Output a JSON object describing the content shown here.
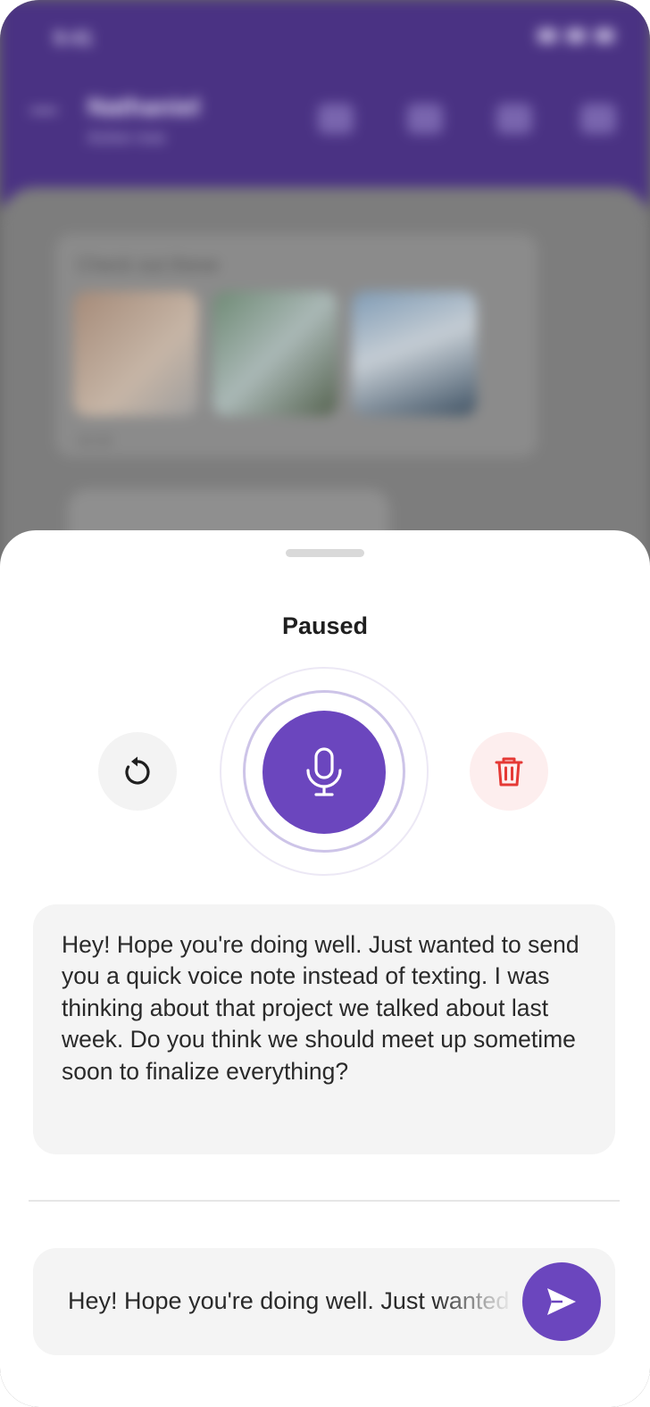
{
  "background_app": {
    "status_time": "9:41",
    "title": "Nathaniel",
    "subtitle": "Active now",
    "card_title": "Check out these",
    "card_meta": "10:32"
  },
  "recorder": {
    "status": "Paused",
    "transcript": "Hey! Hope you're doing well. Just wanted to send you a quick voice note instead of texting. I was thinking about that project we talked about last week. Do you think we should meet up sometime soon to finalize everything?",
    "input_preview": "Hey! Hope you're doing well. Just wanted to send you a quick voice note instead of texting."
  },
  "icons": {
    "restart": "restart-icon",
    "mic": "microphone-icon",
    "delete": "trash-icon",
    "send": "send-icon"
  },
  "colors": {
    "accent": "#6b46be",
    "header": "#4a3283",
    "delete": "#e53935",
    "delete_bg": "#fdeeee"
  }
}
